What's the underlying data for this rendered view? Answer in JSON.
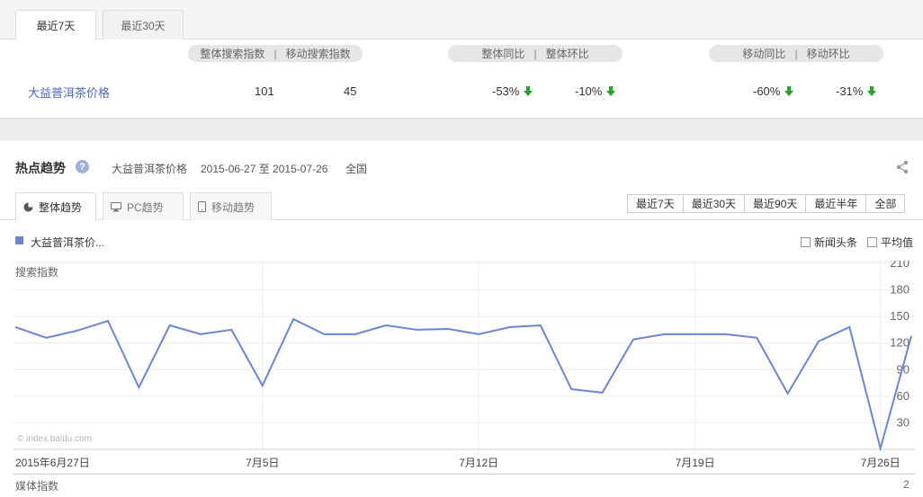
{
  "top_tabs": [
    {
      "label": "最近7天",
      "active": true
    },
    {
      "label": "最近30天",
      "active": false
    }
  ],
  "headers": {
    "search_index": "整体搜索指数",
    "mobile_search_index": "移动搜索指数",
    "overall_yoy": "整体同比",
    "overall_mom": "整体环比",
    "mobile_yoy": "移动同比",
    "mobile_mom": "移动环比",
    "separator": "|"
  },
  "keyword_row": {
    "keyword": "大益普洱茶价格",
    "search_index": "101",
    "mobile_search_index": "45",
    "overall_yoy": "-53%",
    "overall_mom": "-10%",
    "mobile_yoy": "-60%",
    "mobile_mom": "-31%"
  },
  "trend": {
    "title": "热点趋势",
    "help_icon": "?",
    "keyword": "大益普洱茶价格",
    "date_range": "2015-06-27 至 2015-07-26",
    "region": "全国",
    "sub_tabs": [
      {
        "label": "整体趋势",
        "icon": "pie-icon",
        "active": true
      },
      {
        "label": "PC趋势",
        "icon": "monitor-icon",
        "active": false
      },
      {
        "label": "移动趋势",
        "icon": "phone-icon",
        "active": false
      }
    ],
    "ranges": [
      "最近7天",
      "最近30天",
      "最近90天",
      "最近半年",
      "全部"
    ],
    "legend_label": "大益普洱茶价...",
    "checkbox_news": "新闻头条",
    "checkbox_avg": "平均值",
    "watermark": "© index.baidu.com",
    "media_label": "媒体指数",
    "media_value": "2",
    "colors": {
      "series": "#6d84d3",
      "down": "#2ca02c",
      "link": "#4a6ab6"
    }
  },
  "chart_data": {
    "type": "line",
    "ylabel": "搜索指数",
    "ylim": [
      0,
      210
    ],
    "yticks": [
      30,
      60,
      90,
      120,
      150,
      180,
      210
    ],
    "x": [
      "2015-06-27",
      "2015-06-28",
      "2015-06-29",
      "2015-06-30",
      "2015-07-01",
      "2015-07-02",
      "2015-07-03",
      "2015-07-04",
      "2015-07-05",
      "2015-07-06",
      "2015-07-07",
      "2015-07-08",
      "2015-07-09",
      "2015-07-10",
      "2015-07-11",
      "2015-07-12",
      "2015-07-13",
      "2015-07-14",
      "2015-07-15",
      "2015-07-16",
      "2015-07-17",
      "2015-07-18",
      "2015-07-19",
      "2015-07-20",
      "2015-07-21",
      "2015-07-22",
      "2015-07-23",
      "2015-07-24",
      "2015-07-25",
      "2015-07-26"
    ],
    "xtick_labels": [
      {
        "index": 0,
        "label": "2015年6月27日"
      },
      {
        "index": 8,
        "label": "7月5日"
      },
      {
        "index": 15,
        "label": "7月12日"
      },
      {
        "index": 22,
        "label": "7月19日"
      },
      {
        "index": 28,
        "label": "7月26日"
      }
    ],
    "series": [
      {
        "values": [
          138,
          126,
          134,
          145,
          70,
          140,
          130,
          135,
          72,
          147,
          130,
          130,
          140,
          135,
          136,
          130,
          138,
          140,
          68,
          64,
          124,
          130,
          130,
          130,
          126,
          63,
          122,
          138,
          1,
          128
        ]
      }
    ],
    "grid": true
  }
}
